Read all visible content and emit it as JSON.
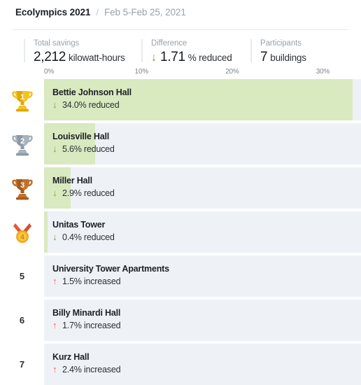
{
  "header": {
    "title": "Ecolympics 2021",
    "separator": "/",
    "date_range": "Feb 5-Feb 25, 2021"
  },
  "stats": [
    {
      "label": "Total savings",
      "value": "2,212",
      "unit": "kilowatt-hours",
      "arrow": ""
    },
    {
      "label": "Difference",
      "value": "1.71",
      "unit": "% reduced",
      "arrow": "↓"
    },
    {
      "label": "Participants",
      "value": "7",
      "unit": "buildings",
      "arrow": ""
    }
  ],
  "colors": {
    "bar_fill_green": "#d9e9c0",
    "row_background": "#eef2f6",
    "reduced_green": "#6aa829",
    "increased_red": "#f4604f",
    "gold": "#f5c220",
    "silver": "#a7b3bd",
    "bronze": "#c0722c",
    "medal_ribbon": "#e25a33"
  },
  "chart_data": {
    "type": "bar",
    "title": "Ecolympics 2021 Building Leaderboard",
    "xlabel": "",
    "ylabel": "",
    "orientation": "horizontal",
    "xlim": [
      0,
      35
    ],
    "grid": false,
    "axis_ticks": [
      {
        "label": "0%",
        "value": 0
      },
      {
        "label": "10%",
        "value": 10
      },
      {
        "label": "20%",
        "value": 20
      },
      {
        "label": "30%",
        "value": 30
      }
    ],
    "categories": [
      "Bettie Johnson Hall",
      "Louisville Hall",
      "Miller Hall",
      "Unitas Tower",
      "University Tower Apartments",
      "Billy Minardi Hall",
      "Kurz Hall"
    ],
    "values": [
      34.0,
      5.6,
      2.9,
      0.4,
      -1.5,
      -1.7,
      -2.4
    ]
  },
  "rows": [
    {
      "rank": "1",
      "medal": "gold-trophy",
      "name": "Bettie Johnson Hall",
      "arrow": "↓",
      "change": "34.0% reduced",
      "percent": 34.0,
      "direction": "reduced"
    },
    {
      "rank": "2",
      "medal": "silver-trophy",
      "name": "Louisville Hall",
      "arrow": "↓",
      "change": "5.6% reduced",
      "percent": 5.6,
      "direction": "reduced"
    },
    {
      "rank": "3",
      "medal": "bronze-trophy",
      "name": "Miller Hall",
      "arrow": "↓",
      "change": "2.9% reduced",
      "percent": 2.9,
      "direction": "reduced"
    },
    {
      "rank": "4",
      "medal": "medal-ribbon",
      "name": "Unitas Tower",
      "arrow": "↓",
      "change": "0.4% reduced",
      "percent": 0.4,
      "direction": "reduced"
    },
    {
      "rank": "5",
      "medal": "number",
      "name": "University Tower Apartments",
      "arrow": "↑",
      "change": "1.5% increased",
      "percent": 1.5,
      "direction": "increased"
    },
    {
      "rank": "6",
      "medal": "number",
      "name": "Billy Minardi Hall",
      "arrow": "↑",
      "change": "1.7% increased",
      "percent": 1.7,
      "direction": "increased"
    },
    {
      "rank": "7",
      "medal": "number",
      "name": "Kurz Hall",
      "arrow": "↑",
      "change": "2.4% increased",
      "percent": 2.4,
      "direction": "increased"
    }
  ]
}
